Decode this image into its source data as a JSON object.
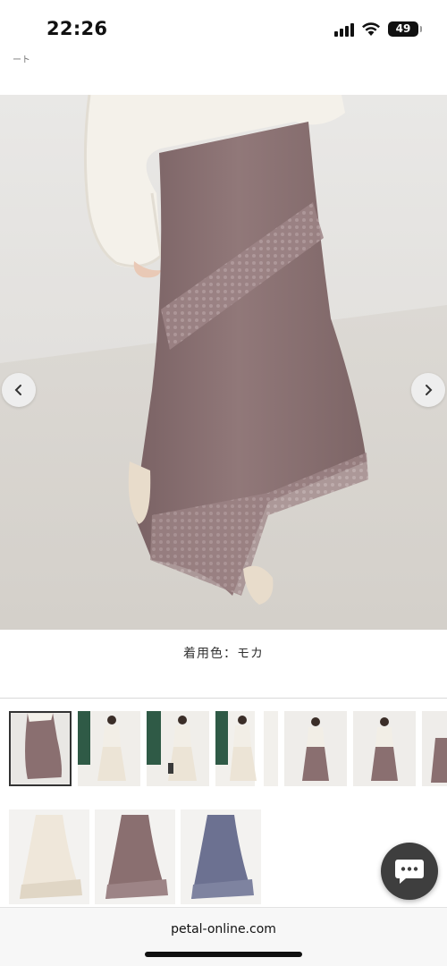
{
  "status_bar": {
    "time": "22:26",
    "battery": "49",
    "icons": [
      "signal-icon",
      "wifi-icon",
      "battery-icon"
    ]
  },
  "nav": {
    "breadcrumb": "ート"
  },
  "product": {
    "color_caption": "着用色：モカ",
    "colors": {
      "mocha": "#8a6f70",
      "ivory": "#efe7da",
      "navy": "#6c7191"
    }
  },
  "carousel": {
    "prev_icon": "chevron-left-icon",
    "next_icon": "chevron-right-icon"
  },
  "thumbnails": [
    "mocha",
    "ivory",
    "ivory",
    "ivory",
    "mocha",
    "mocha",
    "mocha"
  ],
  "swatches": [
    "ivory",
    "mocha",
    "navy"
  ],
  "chat": {
    "icon": "chat-bubble-icon"
  },
  "browser": {
    "url": "petal-online.com"
  }
}
